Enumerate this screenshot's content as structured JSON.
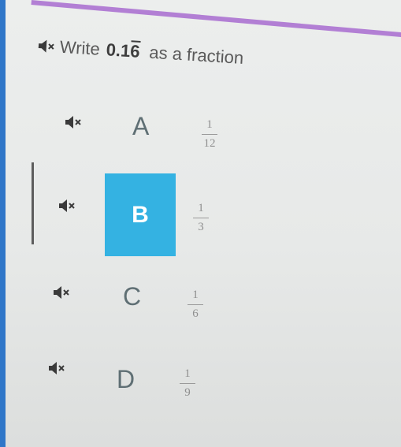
{
  "question": {
    "prefix": "Write",
    "number_int": "0.1",
    "number_repeat": "6",
    "suffix": "as a fraction"
  },
  "choices": [
    {
      "letter": "A",
      "numerator": "1",
      "denominator": "12"
    },
    {
      "letter": "B",
      "numerator": "1",
      "denominator": "3",
      "selected": true
    },
    {
      "letter": "C",
      "numerator": "1",
      "denominator": "6"
    },
    {
      "letter": "D",
      "numerator": "1",
      "denominator": "9"
    }
  ],
  "icons": {
    "speaker": "speaker-muted-icon"
  },
  "colors": {
    "selected_fill": "#34b2e2",
    "accent_left": "#2f76c8",
    "top_stripe": "#b27fd4"
  }
}
